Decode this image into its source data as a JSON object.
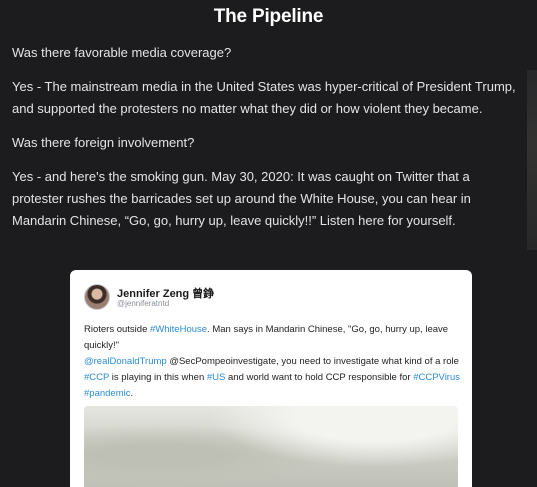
{
  "header": {
    "title": "The Pipeline"
  },
  "article": {
    "paragraphs": [
      "Was there favorable media coverage?",
      "Yes - The mainstream media in the United States was hyper-critical of President Trump, and supported the protesters no matter what they did or how violent they became.",
      "Was there foreign involvement?",
      "Yes - and here's the smoking gun. May 30, 2020: It was caught on Twitter that a protester rushes the barricades set up around the White House, you can hear in Mandarin Chinese, “Go, go, hurry up, leave quickly!!” Listen here for yourself."
    ]
  },
  "tweet": {
    "author_name": "Jennifer Zeng 曾錚",
    "author_handle": "@jenniferatntd",
    "text_1": "Rioters outside ",
    "hashtag_whitehouse": "#WhiteHouse",
    "text_2": ". Man says in Mandarin Chinese, \"Go, go, hurry up, leave quickly!\"",
    "mention_trump": "@realDonaldTrump",
    "text_3": " @SecPompeoinvestigate, you need to investigate what kind of a role ",
    "hashtag_ccp": "#CCP",
    "text_4": " is playing in this when ",
    "hashtag_us": "#US",
    "text_5": " and world want to hold CCP responsible for ",
    "hashtag_ccpvirus": "#CCPVirus",
    "text_6": " ",
    "hashtag_pandemic": "#pandemic",
    "text_7": ".",
    "link_color": "#2a8bd6"
  },
  "icons": {
    "avatar": "profile-photo"
  }
}
